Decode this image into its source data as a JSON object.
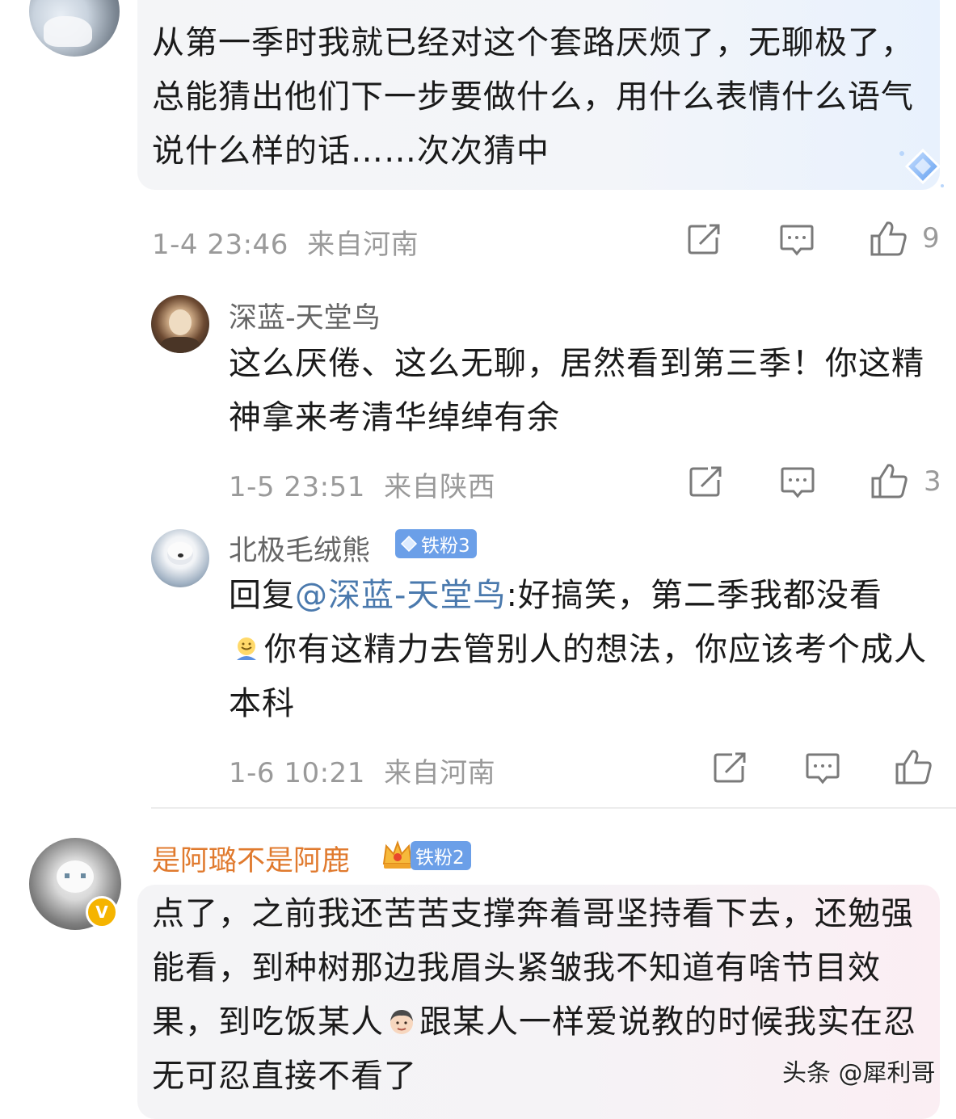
{
  "comments": [
    {
      "text": "从第一季时我就已经对这个套路厌烦了，无聊极了，总能猜出他们下一步要做什么，用什么表情什么语气说什么样的话……次次猜中",
      "time": "1-4 23:46",
      "location": "来自河南",
      "likes": "9"
    },
    {
      "username": "深蓝-天堂鸟",
      "text": "这么厌倦、这么无聊，居然看到第三季！你这精神拿来考清华绰绰有余",
      "time": "1-5 23:51",
      "location": "来自陕西",
      "likes": "3"
    },
    {
      "username": "北极毛绒熊",
      "fan_badge": "铁粉3",
      "reply_prefix": "回复",
      "mention": "@深蓝-天堂鸟",
      "text_a": ":好搞笑，第二季我都没看",
      "text_b": "你有这精力去管别人的想法，你应该考个成人本科",
      "time": "1-6 10:21",
      "location": "来自河南"
    },
    {
      "username": "是阿璐不是阿鹿",
      "fan_badge": "铁粉2",
      "text_a": "点了，之前我还苦苦支撑奔着哥坚持看下去，还勉强能看，到种树那边我眉头紧皱我不知道有啥节目效果，到吃饭某人",
      "text_b": "跟某人一样爱说教的时候我实在忍无可忍直接不看了"
    }
  ],
  "watermark": "头条 @犀利哥",
  "icons": {
    "share": "share-icon",
    "comment": "comment-icon",
    "like": "thumbs-up-icon",
    "verified": "verified-v-icon",
    "crown": "crown-icon",
    "gem": "diamond-icon"
  },
  "colors": {
    "mention": "#4a79ad",
    "orange_username": "#e07a2e",
    "fan_badge": "#6b9fe8",
    "meta_gray": "#9a9a9a"
  }
}
